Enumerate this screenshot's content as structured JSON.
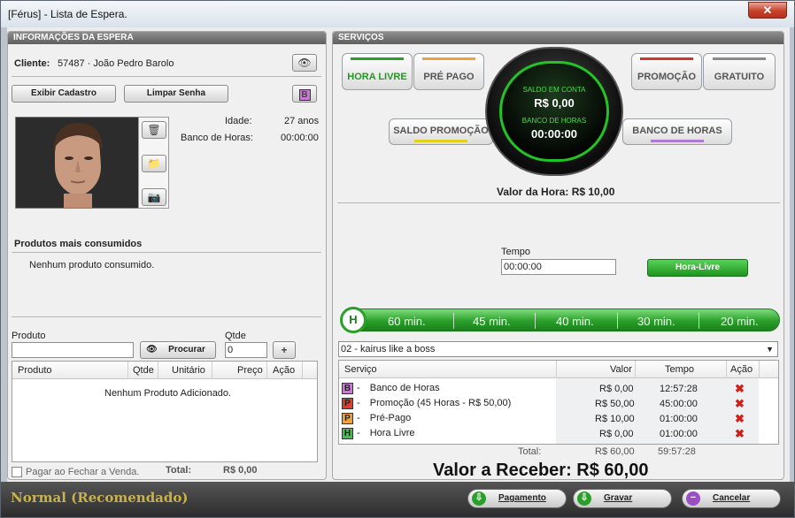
{
  "window": {
    "title": "[Férus] - Lista de Espera.",
    "close": "✕"
  },
  "left": {
    "header": "INFORMAÇÕES DA ESPERA",
    "client_label": "Cliente:",
    "client_value": "57487 · João Pedro Barolo",
    "btn_cadastro": "Exibir Cadastro",
    "btn_limpar": "Limpar Senha",
    "b_badge": "B",
    "idade_label": "Idade:",
    "idade_value": "27 anos",
    "banco_label": "Banco de Horas:",
    "banco_value": "00:00:00",
    "produtos_title": "Produtos mais consumidos",
    "produtos_empty": "Nenhum produto consumido.",
    "produto_label": "Produto",
    "qtde_label": "Qtde",
    "qtde_value": "0",
    "btn_procurar": "Procurar",
    "grid_headers": [
      "Produto",
      "Qtde",
      "Unitário",
      "Preço",
      "Ação"
    ],
    "grid_empty": "Nenhum Produto Adicionado.",
    "pagar_label": "Pagar ao Fechar a Venda.",
    "total_label": "Total:",
    "total_value": "R$ 0,00"
  },
  "right": {
    "header": "SERVIÇOS",
    "tabs_top": [
      "HORA LIVRE",
      "PRÉ PAGO",
      "PROMOÇÃO",
      "GRATUITO"
    ],
    "tabs_bottom": [
      "SALDO PROMOÇÃO",
      "BANCO DE HORAS"
    ],
    "gauge": {
      "saldo_label": "SALDO EM CONTA",
      "saldo_value": "R$ 0,00",
      "banco_label": "BANCO DE HORAS",
      "banco_value": "00:00:00"
    },
    "valor_hora": "Valor da Hora: R$ 10,00",
    "tempo_label": "Tempo",
    "tempo_value": "00:00:00",
    "btn_hora_livre": "Hora-Livre",
    "h_badge": "H",
    "time_options": [
      "60 min.",
      "45 min.",
      "40 min.",
      "30 min.",
      "20 min."
    ],
    "select_value": "02 - kairus like a boss",
    "grid_headers": [
      "Serviço",
      "Valor",
      "Tempo",
      "Ação"
    ],
    "rows": [
      {
        "badge": "B",
        "name": "Banco de Horas",
        "valor": "R$ 0,00",
        "tempo": "12:57:28"
      },
      {
        "badge": "P",
        "name": "Promoção  (45 Horas - R$ 50,00)",
        "valor": "R$ 50,00",
        "tempo": "45:00:00"
      },
      {
        "badge": "P",
        "name": "Pré-Pago",
        "valor": "R$ 10,00",
        "tempo": "01:00:00"
      },
      {
        "badge": "H",
        "name": "Hora Livre",
        "valor": "R$ 0,00",
        "tempo": "01:00:00"
      }
    ],
    "total_label": "Total:",
    "total_valor": "R$ 60,00",
    "total_tempo": "59:57:28",
    "valor_receber": "Valor a Receber: R$ 60,00"
  },
  "status": {
    "mode": "Normal (Recomendado)",
    "btn_pagamento": "Pagamento",
    "btn_gravar": "Gravar",
    "btn_cancelar": "Cancelar"
  },
  "colors": {
    "accent_green": "#2aa02a",
    "badge_B": "#c77bd4",
    "badge_P_red": "#e03b2e",
    "badge_P_orange": "#f0a23a",
    "badge_H": "#3cc24a",
    "status_text": "#c9b24a"
  }
}
